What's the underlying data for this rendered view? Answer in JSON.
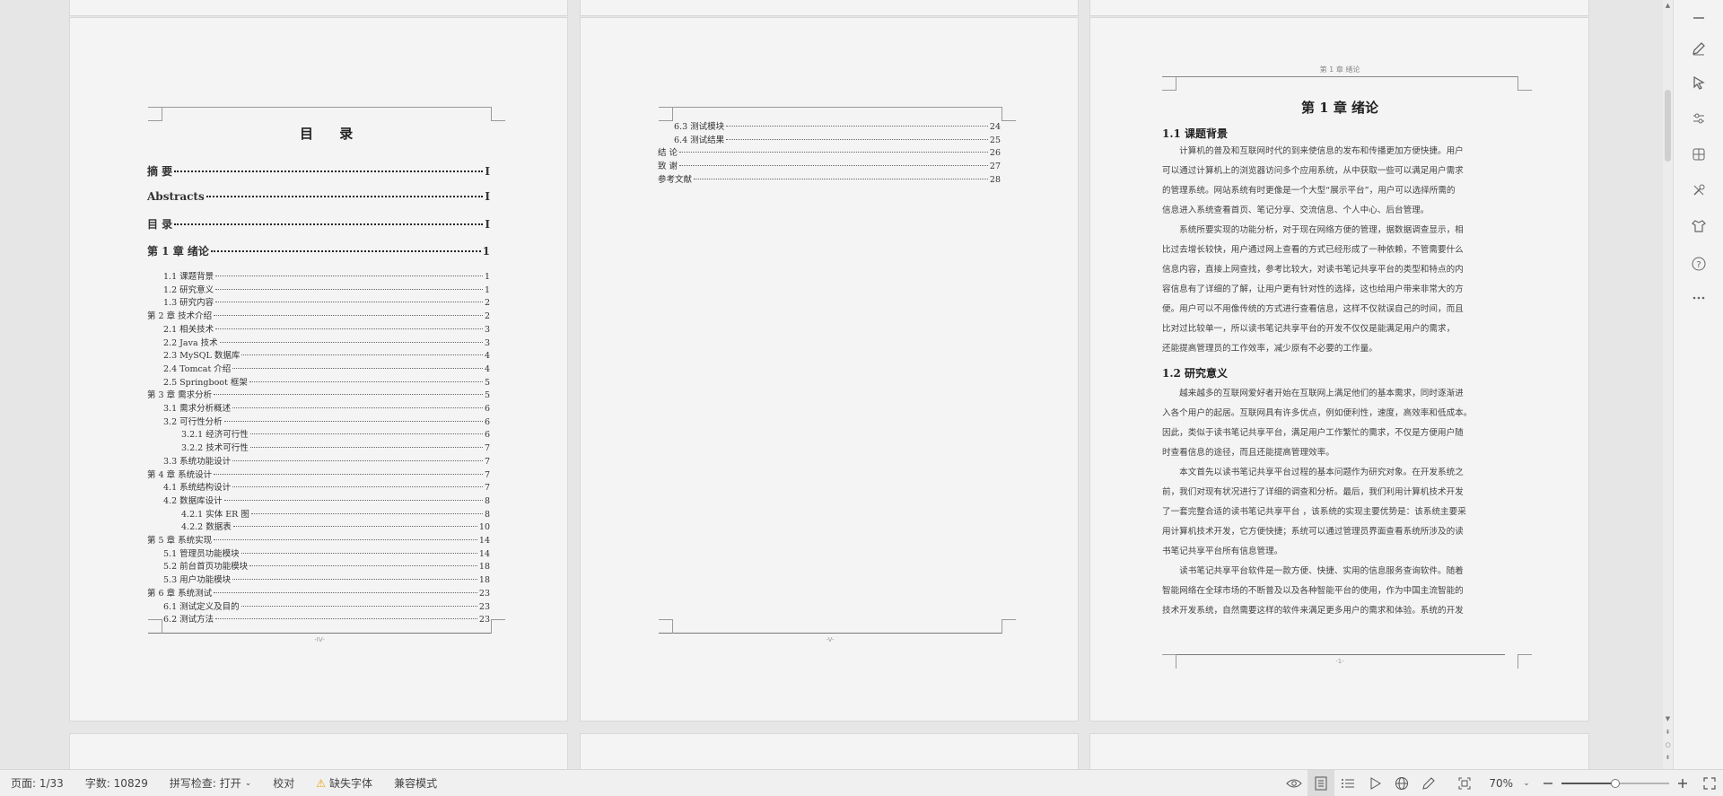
{
  "pages": {
    "toc": {
      "title": "目  录",
      "footer": "-IV-",
      "entries": [
        {
          "text": "摘  要",
          "page": "I",
          "level": "major"
        },
        {
          "text": "Abstracts",
          "page": "I",
          "level": "major"
        },
        {
          "text": "目  录",
          "page": "I",
          "level": "major"
        },
        {
          "text": "第 1 章  绪论",
          "page": "1",
          "level": "major"
        },
        {
          "text": "1.1 课题背景",
          "page": "1",
          "level": "l1"
        },
        {
          "text": "1.2 研究意义",
          "page": "1",
          "level": "l1"
        },
        {
          "text": "1.3 研究内容",
          "page": "2",
          "level": "l1"
        },
        {
          "text": "第 2 章  技术介绍",
          "page": "2",
          "level": "l0"
        },
        {
          "text": "2.1 相关技术",
          "page": "3",
          "level": "l1"
        },
        {
          "text": "2.2 Java 技术",
          "page": "3",
          "level": "l1"
        },
        {
          "text": "2.3 MySQL 数据库",
          "page": "4",
          "level": "l1"
        },
        {
          "text": "2.4 Tomcat 介绍",
          "page": "4",
          "level": "l1"
        },
        {
          "text": "2.5 Springboot 框架",
          "page": "5",
          "level": "l1"
        },
        {
          "text": "第 3 章  需求分析",
          "page": "5",
          "level": "l0"
        },
        {
          "text": "3.1 需求分析概述",
          "page": "6",
          "level": "l1"
        },
        {
          "text": "3.2 可行性分析",
          "page": "6",
          "level": "l1"
        },
        {
          "text": "3.2.1 经济可行性",
          "page": "6",
          "level": "l2"
        },
        {
          "text": "3.2.2 技术可行性",
          "page": "7",
          "level": "l2"
        },
        {
          "text": "3.3 系统功能设计",
          "page": "7",
          "level": "l1"
        },
        {
          "text": "第 4 章  系统设计",
          "page": "7",
          "level": "l0"
        },
        {
          "text": "4.1 系统结构设计",
          "page": "7",
          "level": "l1"
        },
        {
          "text": "4.2 数据库设计",
          "page": "8",
          "level": "l1"
        },
        {
          "text": "4.2.1 实体 ER 图",
          "page": "8",
          "level": "l2"
        },
        {
          "text": "4.2.2 数据表",
          "page": "10",
          "level": "l2"
        },
        {
          "text": "第 5 章  系统实现",
          "page": "14",
          "level": "l0"
        },
        {
          "text": "5.1 管理员功能模块",
          "page": "14",
          "level": "l1"
        },
        {
          "text": "5.2 前台首页功能模块",
          "page": "18",
          "level": "l1"
        },
        {
          "text": "5.3 用户功能模块",
          "page": "18",
          "level": "l1"
        },
        {
          "text": "第 6 章  系统测试",
          "page": "23",
          "level": "l0"
        },
        {
          "text": "6.1 测试定义及目的",
          "page": "23",
          "level": "l1"
        },
        {
          "text": "6.2 测试方法",
          "page": "23",
          "level": "l1"
        }
      ]
    },
    "toc2": {
      "footer": "-V-",
      "entries": [
        {
          "text": "6.3 测试模块",
          "page": "24",
          "level": "l1"
        },
        {
          "text": "6.4 测试结果",
          "page": "25",
          "level": "l1"
        },
        {
          "text": "结  论",
          "page": "26",
          "level": "l0"
        },
        {
          "text": "致  谢",
          "page": "27",
          "level": "l0"
        },
        {
          "text": "参考文献",
          "page": "28",
          "level": "l0"
        }
      ]
    },
    "chapter": {
      "running_head": "第 1 章  绪论",
      "title": "第 1 章  绪论",
      "footer": "-1-",
      "sections": [
        {
          "heading": "1.1 课题背景",
          "paragraphs": [
            [
              "　　计算机的普及和互联网时代的到来使信息的发布和传播更加方便快捷。用户",
              "可以通过计算机上的浏览器访问多个应用系统，从中获取一些可以满足用户需求",
              "的管理系统。网站系统有时更像是一个大型“展示平台”，用户可以选择所需的",
              "信息进入系统查看首页、笔记分享、交流信息、个人中心、后台管理。"
            ],
            [
              "　　系统所要实现的功能分析，对于现在网络方便的管理，据数据调查显示，相",
              "比过去增长较快，用户通过网上查看的方式已经形成了一种依赖，不管需要什么",
              "信息内容，直接上网查找，参考比较大，对读书笔记共享平台的类型和特点的内",
              "容信息有了详细的了解，让用户更有针对性的选择，这也给用户带来非常大的方",
              "便。用户可以不用像传统的方式进行查看信息，这样不仅就误自己的时间，而且",
              "比对过比较单一，所以读书笔记共享平台的开发不仅仅是能满足用户的需求，",
              "还能提高管理员的工作效率，减少原有不必要的工作量。"
            ]
          ]
        },
        {
          "heading": "1.2 研究意义",
          "paragraphs": [
            [
              "　　越来越多的互联网爱好者开始在互联网上满足他们的基本需求，同时逐渐进",
              "入各个用户的起居。互联网具有许多优点，例如便利性，速度，高效率和低成本。",
              "因此，类似于读书笔记共享平台，满足用户工作繁忙的需求，不仅是方便用户随",
              "时查看信息的途径，而且还能提高管理效率。"
            ],
            [
              "　　本文首先以读书笔记共享平台过程的基本问题作为研究对象。在开发系统之",
              "前，我们对现有状况进行了详细的调查和分析。最后，我们利用计算机技术开发",
              "了一套完整合适的读书笔记共享平台 ，该系统的实现主要优势是：该系统主要采",
              "用计算机技术开发，它方便快捷；系统可以通过管理员界面查看系统所涉及的读",
              "书笔记共享平台所有信息管理。"
            ],
            [
              "　　读书笔记共享平台软件是一款方便、快捷、实用的信息服务查询软件。随着",
              "智能网络在全球市场的不断普及以及各种智能平台的使用，作为中国主流智能的",
              "技术开发系统，自然需要这样的软件来满足更多用户的需求和体验。系统的开发"
            ]
          ]
        }
      ]
    }
  },
  "status_bar": {
    "page": "页面: 1/33",
    "words": "字数: 10829",
    "spellcheck": "拼写检查: 打开",
    "proofread": "校对",
    "missing_font": "缺失字体",
    "compat_mode": "兼容模式",
    "zoom": "70%",
    "zoom_level": 0.5
  },
  "icons": {
    "right_toolbar": [
      "minimize-icon",
      "edit-pen-icon",
      "select-cursor-icon",
      "adjust-icon",
      "table-tool-icon",
      "tools-icon",
      "skin-icon",
      "help-icon",
      "more-icon"
    ]
  }
}
